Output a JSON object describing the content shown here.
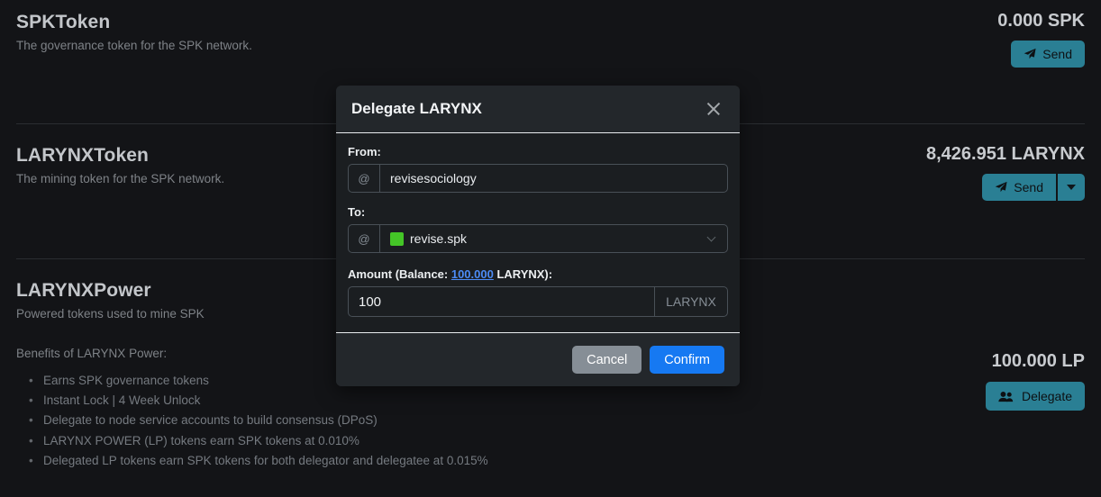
{
  "tokens": [
    {
      "name": "SPKToken",
      "desc": "The governance token for the SPK network.",
      "balance": "0.000 SPK",
      "send_label": "Send"
    },
    {
      "name": "LARYNXToken",
      "desc": "The mining token for the SPK network.",
      "balance": "8,426.951 LARYNX",
      "send_label": "Send"
    },
    {
      "name": "LARYNXPower",
      "desc": "Powered tokens used to mine SPK",
      "balance": "100.000 LP",
      "delegate_label": "Delegate",
      "benefits_heading": "Benefits of LARYNX Power:",
      "benefits": [
        "Earns SPK governance tokens",
        "Instant Lock | 4 Week Unlock",
        "Delegate to node service accounts to build consensus (DPoS)",
        "LARYNX POWER (LP) tokens earn SPK tokens at 0.010%",
        "Delegated LP tokens earn SPK tokens for both delegator and delegatee at 0.015%"
      ]
    }
  ],
  "modal": {
    "title": "Delegate LARYNX",
    "from_label": "From:",
    "from_prefix": "@",
    "from_value": "revisesociology",
    "to_label": "To:",
    "to_prefix": "@",
    "to_value": "revise.spk",
    "to_badge_color": "#44c527",
    "amount_label_prefix": "Amount (Balance: ",
    "amount_balance_link": "100.000",
    "amount_label_suffix": " LARYNX):",
    "amount_value": "100",
    "amount_suffix": "LARYNX",
    "cancel_label": "Cancel",
    "confirm_label": "Confirm"
  },
  "colors": {
    "accent_teal": "#2a7f94",
    "confirm_blue": "#1679f2",
    "cancel_gray": "#868e96",
    "link_blue": "#4c8bf5",
    "page_bg": "#131417"
  }
}
